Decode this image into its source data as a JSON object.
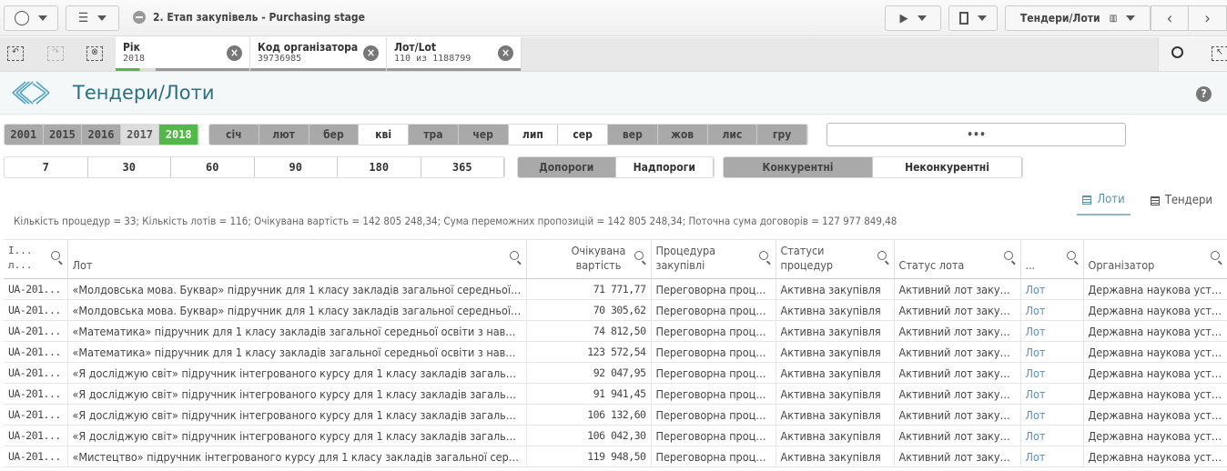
{
  "app_title": "2. Етап закупівель - Purchasing stage",
  "toolbar": {
    "sheet_selector": "Тендери/Лоти"
  },
  "selections": [
    {
      "field": "Рік",
      "value": "2018"
    },
    {
      "field": "Код організатора",
      "value": "39736985"
    },
    {
      "field": "Лот/Lot",
      "value": "110 из 1188799"
    }
  ],
  "sheet": {
    "title": "Тендери/Лоти",
    "help": "?"
  },
  "filters": {
    "years": [
      {
        "label": "2001",
        "state": "excluded"
      },
      {
        "label": "2015",
        "state": "excluded"
      },
      {
        "label": "2016",
        "state": "excluded"
      },
      {
        "label": "2017",
        "state": "alternative"
      },
      {
        "label": "2018",
        "state": "selected"
      }
    ],
    "months": [
      {
        "label": "січ",
        "state": "excluded"
      },
      {
        "label": "лют",
        "state": "excluded"
      },
      {
        "label": "бер",
        "state": "excluded"
      },
      {
        "label": "кві",
        "state": "possible"
      },
      {
        "label": "тра",
        "state": "excluded"
      },
      {
        "label": "чер",
        "state": "excluded"
      },
      {
        "label": "лип",
        "state": "possible"
      },
      {
        "label": "сер",
        "state": "possible"
      },
      {
        "label": "вер",
        "state": "excluded"
      },
      {
        "label": "жов",
        "state": "excluded"
      },
      {
        "label": "лис",
        "state": "excluded"
      },
      {
        "label": "гру",
        "state": "excluded"
      }
    ],
    "more": "•••",
    "days": [
      "7",
      "30",
      "60",
      "90",
      "180",
      "365"
    ],
    "threshold": [
      {
        "label": "Допороги",
        "state": "excluded"
      },
      {
        "label": "Надпороги",
        "state": "possible"
      }
    ],
    "competition": [
      {
        "label": "Конкурентні",
        "state": "excluded"
      },
      {
        "label": "Неконкурентні",
        "state": "possible"
      }
    ]
  },
  "view_tabs": [
    {
      "label": "Лоти",
      "active": true
    },
    {
      "label": "Тендери",
      "active": false
    }
  ],
  "summary": "Кількість процедур = 33; Кількість лотів = 116; Очікувана вартість = 142 805 248,34; Сума переможних пропозицій = 142 805 248,34; Поточна сума договорів = 127 977 849,48",
  "table": {
    "columns": [
      "І... л...",
      "Лот",
      "Очікувана вартість",
      "Процедура закупівлі",
      "Статуси процедур",
      "Статус лота",
      "...",
      "Організатор"
    ],
    "rows": [
      [
        "UA-201...",
        "«Молдовська мова. Буквар» підручник для 1 класу закладів загальної середньої освіти з навчанням молдовською мовою",
        "71 771,77",
        "Переговорна процедура",
        "Активна закупівля",
        "Активний лот закупівлі",
        "Лот",
        "Державна наукова установа"
      ],
      [
        "UA-201...",
        "«Молдовська мова. Буквар» підручник для 1 класу закладів загальної середньої освіти з навчанням молдовською мовою",
        "70 305,62",
        "Переговорна процедура",
        "Активна закупівля",
        "Активний лот закупівлі",
        "Лот",
        "Державна наукова установа"
      ],
      [
        "UA-201...",
        "«Математика» підручник для 1 класу закладів загальної середньої освіти з навчанням мовою",
        "74 812,50",
        "Переговорна процедура",
        "Активна закупівля",
        "Активний лот закупівлі",
        "Лот",
        "Державна наукова установа"
      ],
      [
        "UA-201...",
        "«Математика» підручник для 1 класу закладів загальної середньої освіти з навчанням мовою",
        "123 572,54",
        "Переговорна процедура",
        "Активна закупівля",
        "Активний лот закупівлі",
        "Лот",
        "Державна наукова установа"
      ],
      [
        "UA-201...",
        "«Я досліджую світ» підручник інтегрованого курсу для 1 класу закладів загальної середньої освіти",
        "92 047,95",
        "Переговорна процедура",
        "Активна закупівля",
        "Активний лот закупівлі",
        "Лот",
        "Державна наукова установа"
      ],
      [
        "UA-201...",
        "«Я досліджую світ» підручник інтегрованого курсу для 1 класу закладів загальної середньої освіти",
        "91 941,45",
        "Переговорна процедура",
        "Активна закупівля",
        "Активний лот закупівлі",
        "Лот",
        "Державна наукова установа"
      ],
      [
        "UA-201...",
        "«Я досліджую світ» підручник інтегрованого курсу для 1 класу закладів загальної середньої освіти",
        "106 132,60",
        "Переговорна процедура",
        "Активна закупівля",
        "Активний лот закупівлі",
        "Лот",
        "Державна наукова установа"
      ],
      [
        "UA-201...",
        "«Я досліджую світ» підручник інтегрованого курсу для 1 класу закладів загальної середньої освіти",
        "106 042,30",
        "Переговорна процедура",
        "Активна закупівля",
        "Активний лот закупівлі",
        "Лот",
        "Державна наукова установа"
      ],
      [
        "UA-201...",
        "«Мистецтво» підручник інтегрованого курсу для 1 класу закладів загальної середньої освіти",
        "119 948,50",
        "Переговорна процедура",
        "Активна закупівля",
        "Активний лот закупівлі",
        "Лот",
        "Державна наукова установа"
      ]
    ]
  }
}
